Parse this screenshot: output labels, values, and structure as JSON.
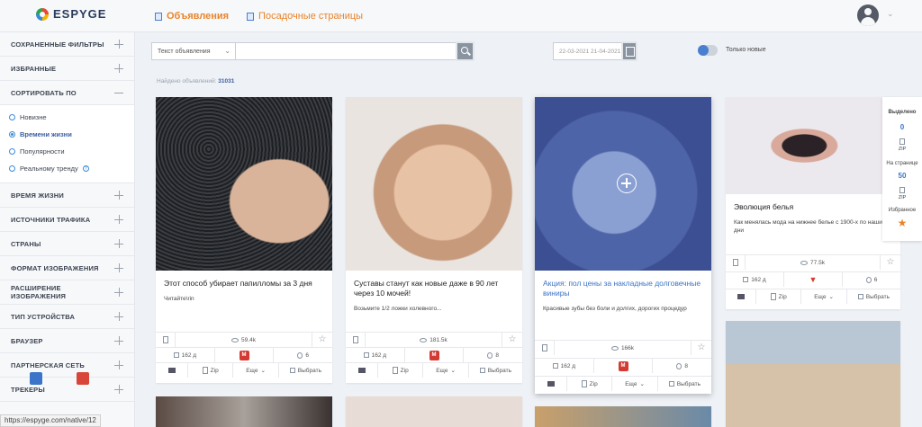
{
  "app": {
    "logo_text": "ESPYGE",
    "nav": [
      {
        "label": "Объявления",
        "active": true
      },
      {
        "label": "Посадочные страницы",
        "active": false
      }
    ]
  },
  "sidebar": {
    "saved_filters": "СОХРАНЕННЫЕ ФИЛЬТРЫ",
    "favorites": "ИЗБРАННЫЕ",
    "sort_by": "СОРТИРОВАТЬ ПО",
    "sort_options": [
      "Новизне",
      "Времени жизни",
      "Популярности",
      "Реальному тренду"
    ],
    "sort_selected": "Времени жизни",
    "sections": [
      "ВРЕМЯ ЖИЗНИ",
      "ИСТОЧНИКИ ТРАФИКА",
      "СТРАНЫ",
      "ФОРМАТ ИЗОБРАЖЕНИЯ",
      "РАСШИРЕНИЕ ИЗОБРАЖЕНИЯ",
      "ТИП УСТРОЙСТВА",
      "БРАУЗЕР",
      "ПАРТНЕРСКАЯ СЕТЬ",
      "ТРЕКЕРЫ"
    ]
  },
  "filters": {
    "ad_type": "Текст объявления",
    "search_value": "",
    "date_range": "22-03-2021 21-04-2021",
    "only_new_label": "Только новые",
    "only_new": true,
    "found_label": "Найдено объявлений:",
    "found_count": "31031"
  },
  "cards": [
    {
      "title": "Этот способ убирает папилломы за 3 дня",
      "desc": "Читайте\\rin",
      "views": "59.4k",
      "days": "162 д",
      "geos": "6",
      "more": "Еще",
      "select": "Выбрать",
      "zip": "Zip",
      "highlight": false
    },
    {
      "title": "Суставы станут как новые даже в 90 лет через 10 мочей!",
      "desc": "Возьмите 1/2 ложки холевного...",
      "views": "181.5k",
      "days": "162 д",
      "geos": "8",
      "more": "Еще",
      "select": "Выбрать",
      "zip": "Zip",
      "highlight": false
    },
    {
      "title": "Акция: пол цены за накладные долговечные виниры",
      "desc": "Красивые зубы без боли и долгих, дорогих процедур",
      "views": "166k",
      "days": "162 д",
      "geos": "8",
      "more": "Еще",
      "select": "Выбрать",
      "zip": "Zip",
      "highlight": true
    },
    {
      "title": "Эволюция белья",
      "desc": "Как менялась мода на нижнее белье с 1900-х по наши дни",
      "views": "77.5k",
      "days": "162 д",
      "geos": "6",
      "more": "Еще",
      "select": "Выбрать",
      "zip": "Zip",
      "highlight": false
    }
  ],
  "selection_panel": {
    "selected_label": "Выделено",
    "selected_count": "0",
    "zip": "ZIP",
    "per_page_label": "На странице",
    "per_page": "50",
    "favorites_label": "Избранное"
  },
  "status_url": "https://espyge.com/native/12"
}
